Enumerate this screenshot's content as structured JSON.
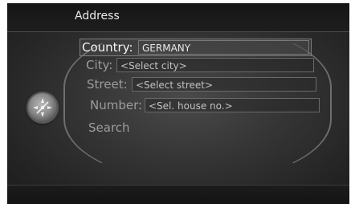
{
  "header": {
    "title": "Address"
  },
  "form": {
    "country": {
      "label": "Country:",
      "value": "GERMANY"
    },
    "city": {
      "label": "City:",
      "placeholder": "<Select city>"
    },
    "street": {
      "label": "Street:",
      "placeholder": "<Select street>"
    },
    "number": {
      "label": "Number:",
      "placeholder": "<Sel. house no.>"
    },
    "search_label": "Search"
  },
  "controls": {
    "knob_icon": "rotary-knob-icon"
  }
}
